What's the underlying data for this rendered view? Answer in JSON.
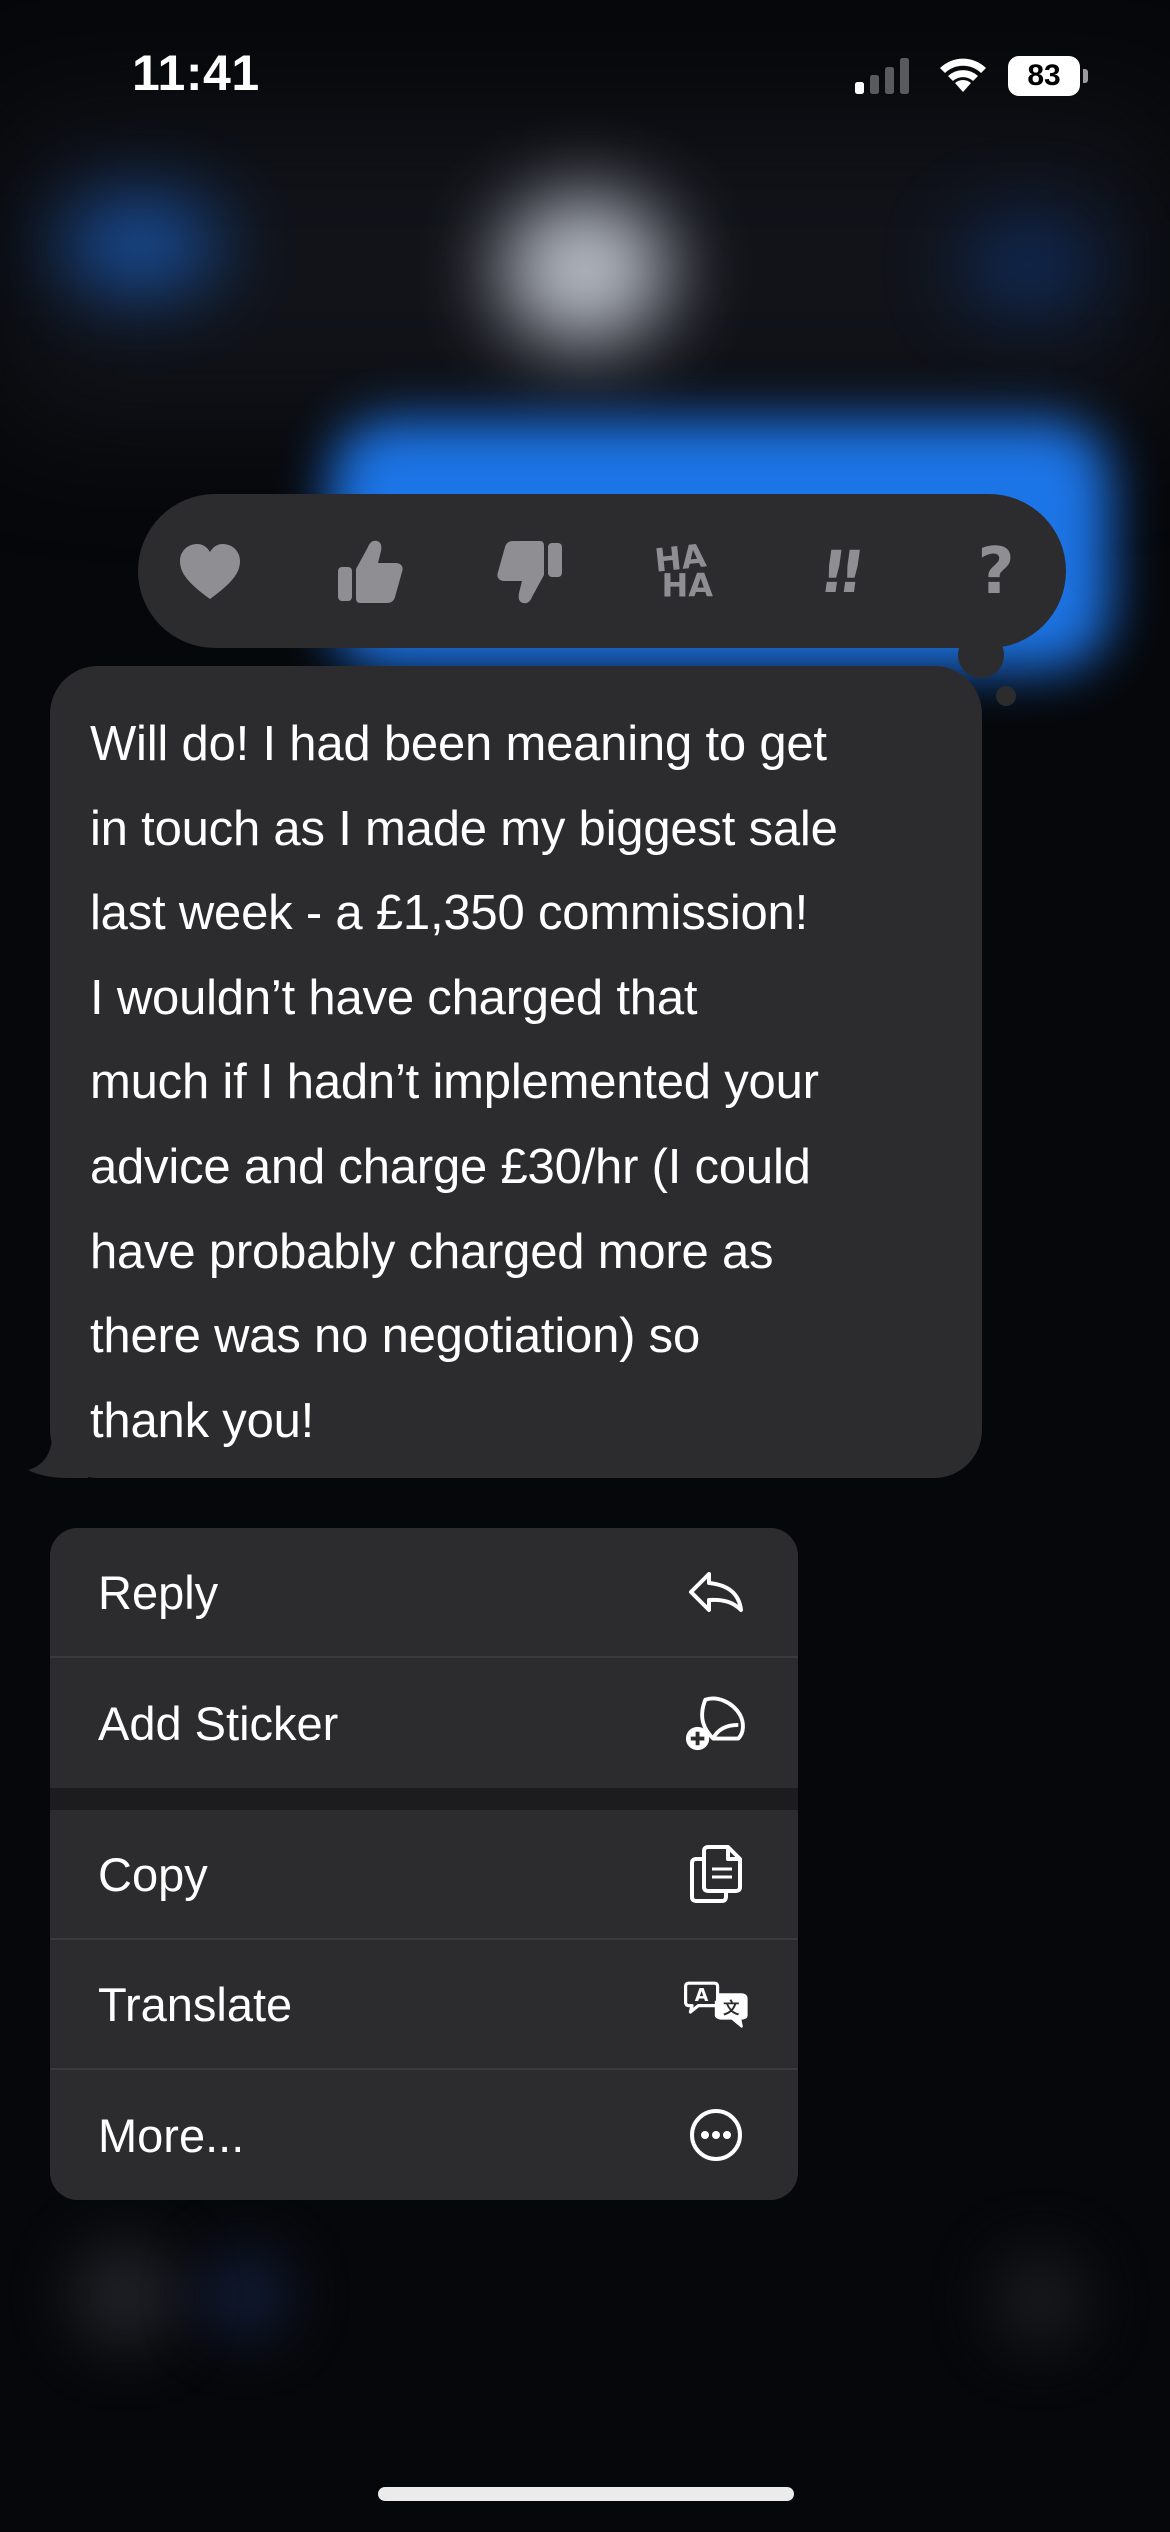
{
  "status_bar": {
    "time": "11:41",
    "battery_level": "83"
  },
  "tapbacks": [
    {
      "name": "heart",
      "icon": "heart-icon"
    },
    {
      "name": "thumbs-up",
      "icon": "thumbs-up-icon"
    },
    {
      "name": "thumbs-down",
      "icon": "thumbs-down-icon"
    },
    {
      "name": "haha",
      "line1": "HA",
      "line2": "HA"
    },
    {
      "name": "emphasize",
      "label": "!!"
    },
    {
      "name": "question",
      "label": "?"
    }
  ],
  "message": {
    "text": "Will do! I had been meaning to get\nin touch as I made my biggest sale\nlast week - a £1,350 commission!\nI wouldn’t have charged that\nmuch if I hadn’t implemented your\nadvice and charge £30/hr (I could\nhave probably charged more as\nthere was no negotiation) so\nthank you!"
  },
  "menu": {
    "reply": {
      "label": "Reply",
      "icon": "reply-arrow-icon"
    },
    "add_sticker": {
      "label": "Add Sticker",
      "icon": "sticker-icon"
    },
    "copy": {
      "label": "Copy",
      "icon": "copy-icon"
    },
    "translate": {
      "label": "Translate",
      "icon": "translate-icon"
    },
    "more": {
      "label": "More...",
      "icon": "ellipsis-circle-icon"
    }
  },
  "colors": {
    "background": "#06070a",
    "bubble": "#2c2c2e",
    "blurred_sent_bubble": "#1e7bf3",
    "tapback_icon": "#8e8e93",
    "text": "#ffffff"
  }
}
